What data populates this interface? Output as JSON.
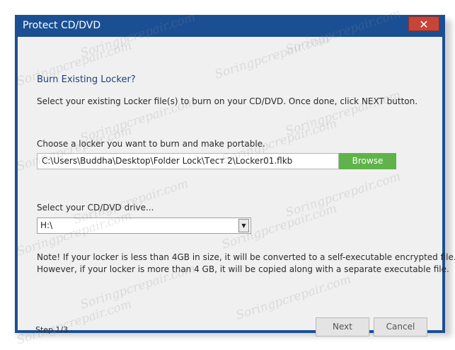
{
  "window": {
    "title": "Protect CD/DVD",
    "close_symbol": "✕"
  },
  "content": {
    "heading": "Burn Existing Locker?",
    "description": "Select your existing Locker file(s) to burn on your CD/DVD. Once done, click NEXT button.",
    "locker_label": "Choose a locker you want to burn and make portable.",
    "locker_path": "C:\\Users\\Buddha\\Desktop\\Folder Lock\\Тест 2\\Locker01.flkb",
    "browse_label": "Browse",
    "drive_label": "Select your CD/DVD drive...",
    "drive_value": "H:\\",
    "note_line1": "Note! If your locker is less than 4GB in size, it will be converted to a self-executable encrypted file.",
    "note_line2": "However, if your locker is more than 4 GB, it will be copied along with a separate executable file."
  },
  "footer": {
    "step": "Step 1/3",
    "next_label": "Next",
    "cancel_label": "Cancel"
  },
  "watermark_text": "Soringpcrepair.com",
  "colors": {
    "titlebar": "#1b4f94",
    "close_button": "#c74438",
    "browse_button": "#5fb34a",
    "heading": "#1e3f7a"
  }
}
